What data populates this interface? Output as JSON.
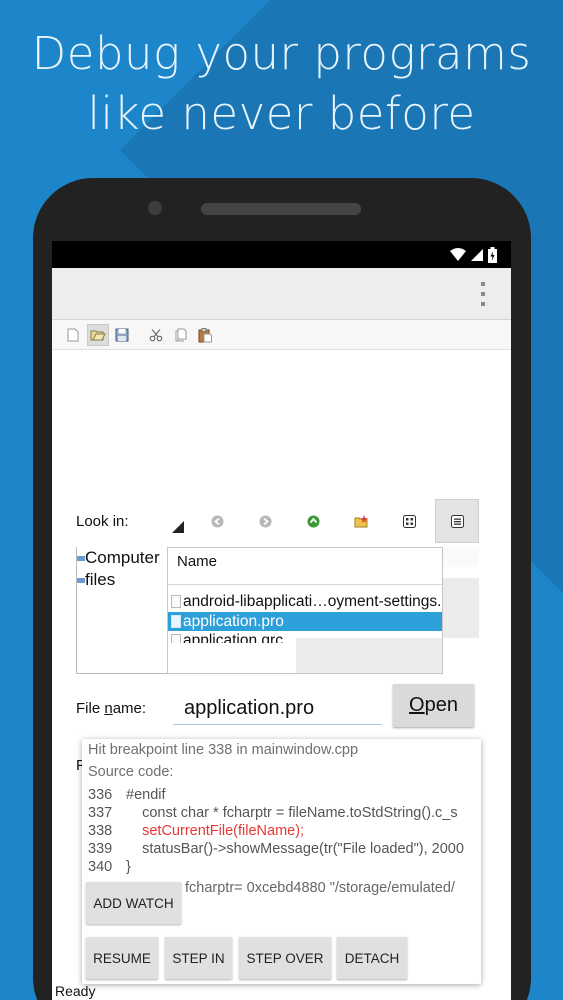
{
  "headline": {
    "line1": "Debug your programs",
    "line2": "like never before"
  },
  "colors": {
    "background": "#1d86cb",
    "selection": "#2d9fd9",
    "breakpoint_line": "#e53935"
  },
  "status_bar": {
    "icons": [
      "wifi-icon",
      "cellular-icon",
      "battery-icon"
    ]
  },
  "app_bar": {
    "menu_icon": "overflow-menu-icon"
  },
  "toolbar": {
    "buttons": [
      "new-file-icon",
      "open-file-icon",
      "save-icon",
      "cut-icon",
      "copy-icon",
      "paste-icon"
    ]
  },
  "file_dialog": {
    "look_in_label": "Look in:",
    "nav_buttons": [
      "back-icon",
      "forward-icon",
      "up-folder-icon",
      "new-folder-icon",
      "list-view-icon",
      "detail-view-icon"
    ],
    "sidebar": [
      "Computer",
      "files"
    ],
    "column_header": "Name",
    "files": [
      {
        "name": "android-libapplicati…oyment-settings.",
        "selected": false
      },
      {
        "name": "application.pro",
        "selected": true
      },
      {
        "name": "application.qrc",
        "selected": false
      }
    ],
    "file_name_label_pre": "File ",
    "file_name_label_mnemonic": "n",
    "file_name_label_post": "ame:",
    "file_name_value": "application.pro",
    "open_button_mnemonic": "O",
    "open_button_rest": "pen",
    "partial_label": "F"
  },
  "debugger": {
    "breakpoint_message": "Hit breakpoint line 338 in mainwindow.cpp",
    "source_label": "Source code:",
    "code": [
      {
        "num": "336",
        "text": "#endif",
        "highlight": false
      },
      {
        "num": "337",
        "text": "    const char * fcharptr = fileName.toStdString().c_s",
        "highlight": false
      },
      {
        "num": "338",
        "text": "    setCurrentFile(fileName);",
        "highlight": true
      },
      {
        "num": "339",
        "text": "    statusBar()->showMessage(tr(\"File loaded\"), 2000",
        "highlight": false
      },
      {
        "num": "340",
        "text": "}",
        "highlight": false
      }
    ],
    "add_watch_label": "ADD WATCH",
    "watch_value": "fcharptr= 0xcebd4880 \"/storage/emulated/",
    "buttons": {
      "resume": "RESUME",
      "step_in": "STEP IN",
      "step_over": "STEP OVER",
      "detach": "DETACH"
    }
  },
  "status_text": "Ready"
}
